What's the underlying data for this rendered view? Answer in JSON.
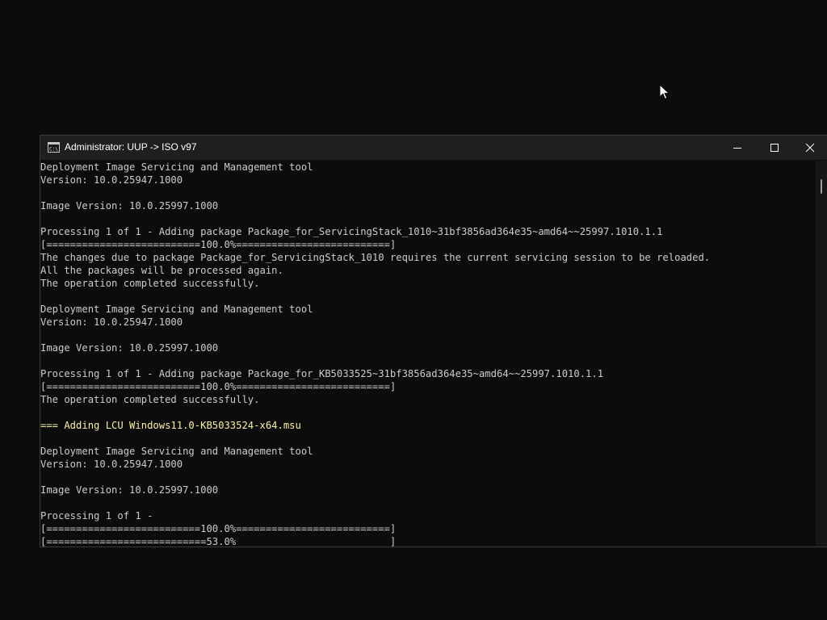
{
  "window": {
    "title": "Administrator:  UUP -> ISO v97"
  },
  "console": {
    "lines": [
      {
        "text": "Deployment Image Servicing and Management tool",
        "color": "#cccccc"
      },
      {
        "text": "Version: 10.0.25947.1000",
        "color": "#cccccc"
      },
      {
        "text": "",
        "color": "#cccccc"
      },
      {
        "text": "Image Version: 10.0.25997.1000",
        "color": "#cccccc"
      },
      {
        "text": "",
        "color": "#cccccc"
      },
      {
        "text": "Processing 1 of 1 - Adding package Package_for_ServicingStack_1010~31bf3856ad364e35~amd64~~25997.1010.1.1",
        "color": "#cccccc"
      },
      {
        "text": "[==========================100.0%==========================]",
        "color": "#cccccc"
      },
      {
        "text": "The changes due to package Package_for_ServicingStack_1010 requires the current servicing session to be reloaded.",
        "color": "#cccccc"
      },
      {
        "text": "All the packages will be processed again.",
        "color": "#cccccc"
      },
      {
        "text": "The operation completed successfully.",
        "color": "#cccccc"
      },
      {
        "text": "",
        "color": "#cccccc"
      },
      {
        "text": "Deployment Image Servicing and Management tool",
        "color": "#cccccc"
      },
      {
        "text": "Version: 10.0.25947.1000",
        "color": "#cccccc"
      },
      {
        "text": "",
        "color": "#cccccc"
      },
      {
        "text": "Image Version: 10.0.25997.1000",
        "color": "#cccccc"
      },
      {
        "text": "",
        "color": "#cccccc"
      },
      {
        "text": "Processing 1 of 1 - Adding package Package_for_KB5033525~31bf3856ad364e35~amd64~~25997.1010.1.1",
        "color": "#cccccc"
      },
      {
        "text": "[==========================100.0%==========================]",
        "color": "#cccccc"
      },
      {
        "text": "The operation completed successfully.",
        "color": "#cccccc"
      },
      {
        "text": "",
        "color": "#cccccc"
      },
      {
        "text": "=== Adding LCU Windows11.0-KB5033524-x64.msu",
        "color": "#f9f1a5"
      },
      {
        "text": "",
        "color": "#cccccc"
      },
      {
        "text": "Deployment Image Servicing and Management tool",
        "color": "#cccccc"
      },
      {
        "text": "Version: 10.0.25947.1000",
        "color": "#cccccc"
      },
      {
        "text": "",
        "color": "#cccccc"
      },
      {
        "text": "Image Version: 10.0.25997.1000",
        "color": "#cccccc"
      },
      {
        "text": "",
        "color": "#cccccc"
      },
      {
        "text": "Processing 1 of 1 -",
        "color": "#cccccc"
      },
      {
        "text": "[==========================100.0%==========================]",
        "color": "#cccccc"
      },
      {
        "text": "[===========================53.0%                          ]",
        "color": "#cccccc"
      }
    ]
  },
  "colors": {
    "background": "#0c0c0c",
    "titlebar": "#1f1f1f",
    "text": "#cccccc",
    "highlight": "#f9f1a5"
  },
  "icons": {
    "app": "cmd-console-icon",
    "minimize": "minimize-icon",
    "maximize": "maximize-icon",
    "close": "close-icon",
    "cursor": "mouse-pointer-icon"
  }
}
